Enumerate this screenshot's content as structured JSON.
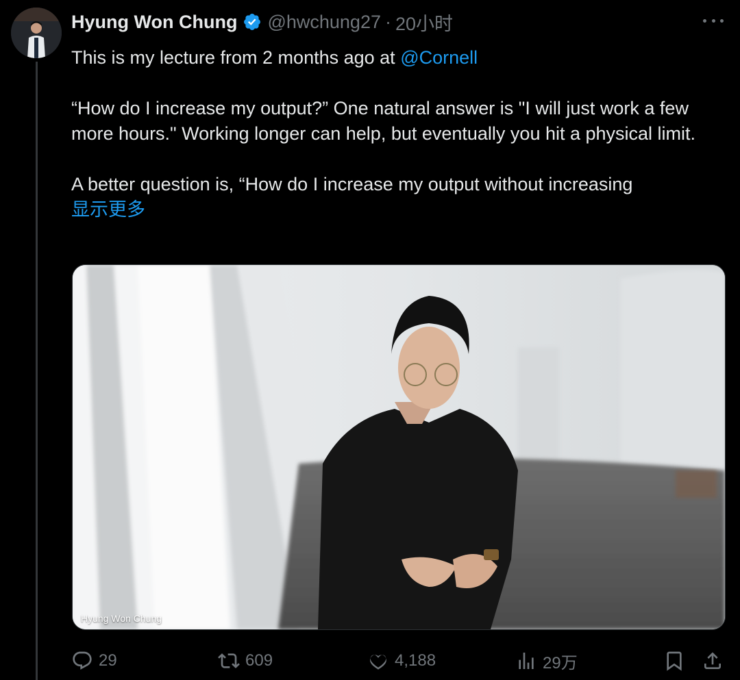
{
  "tweet": {
    "author_name": "Hyung Won Chung",
    "handle": "@hwchung27",
    "separator": "·",
    "time": "20小时",
    "text_line1_prefix": "This is my lecture from 2 months ago at ",
    "mention": "@Cornell",
    "paragraph2": "“How do I increase my output?” One natural answer is \"I will just work a few more hours.\" Working longer can help, but eventually you hit a physical limit.",
    "paragraph3": "A better question is, “How do I increase my output without increasing",
    "show_more": "显示更多"
  },
  "media": {
    "caption": "Hyung Won Chung"
  },
  "actions": {
    "replies": "29",
    "retweets": "609",
    "likes": "4,188",
    "views": "29万"
  },
  "colors": {
    "background": "#000000",
    "text": "#e7e9ea",
    "muted": "#71767b",
    "accent": "#1d9bf0"
  },
  "icons": [
    "verified-icon",
    "more-icon",
    "reply-icon",
    "retweet-icon",
    "like-icon",
    "views-icon",
    "bookmark-icon",
    "share-icon"
  ]
}
